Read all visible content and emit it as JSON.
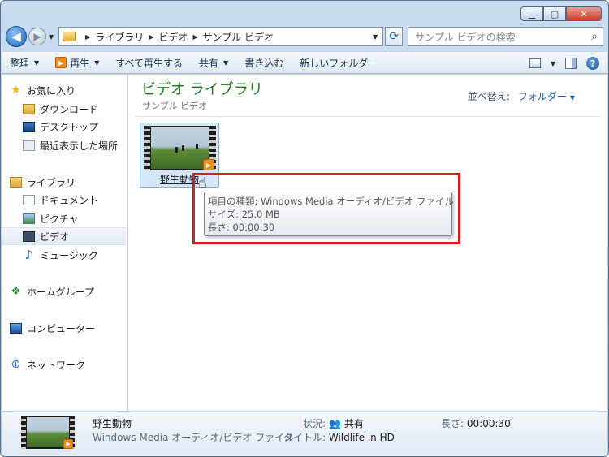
{
  "address": {
    "crumbs": [
      "ライブラリ",
      "ビデオ",
      "サンプル ビデオ"
    ]
  },
  "search": {
    "placeholder": "サンプル ビデオの検索"
  },
  "toolbar": {
    "organize": "整理",
    "play": "再生",
    "play_all": "すべて再生する",
    "share": "共有",
    "burn": "書き込む",
    "new_folder": "新しいフォルダー"
  },
  "nav": {
    "favorites": "お気に入り",
    "downloads": "ダウンロード",
    "desktop": "デスクトップ",
    "recent": "最近表示した場所",
    "libraries": "ライブラリ",
    "documents": "ドキュメント",
    "pictures": "ピクチャ",
    "videos": "ビデオ",
    "music": "ミュージック",
    "homegroup": "ホームグループ",
    "computer": "コンピューター",
    "network": "ネットワーク"
  },
  "content": {
    "title": "ビデオ ライブラリ",
    "subtitle": "サンプル ビデオ",
    "arrange_label": "並べ替え:",
    "arrange_value": "フォルダー",
    "file_name": "野生動物"
  },
  "tooltip": {
    "type": "項目の種類: Windows Media オーディオ/ビデオ ファイル",
    "size": "サイズ: 25.0 MB",
    "length": "長さ: 00:00:30"
  },
  "details": {
    "name": "野生動物",
    "type": "Windows Media オーディオ/ビデオ ファイル",
    "status_label": "状況:",
    "status_value": "共有",
    "title_label": "タイトル:",
    "title_value": "Wildlife in HD",
    "length_label": "長さ:",
    "length_value": "00:00:30"
  },
  "colors": {
    "library_title": "#1e7a1e",
    "highlight_box": "#e01b1b",
    "link": "#1d5cb3"
  }
}
